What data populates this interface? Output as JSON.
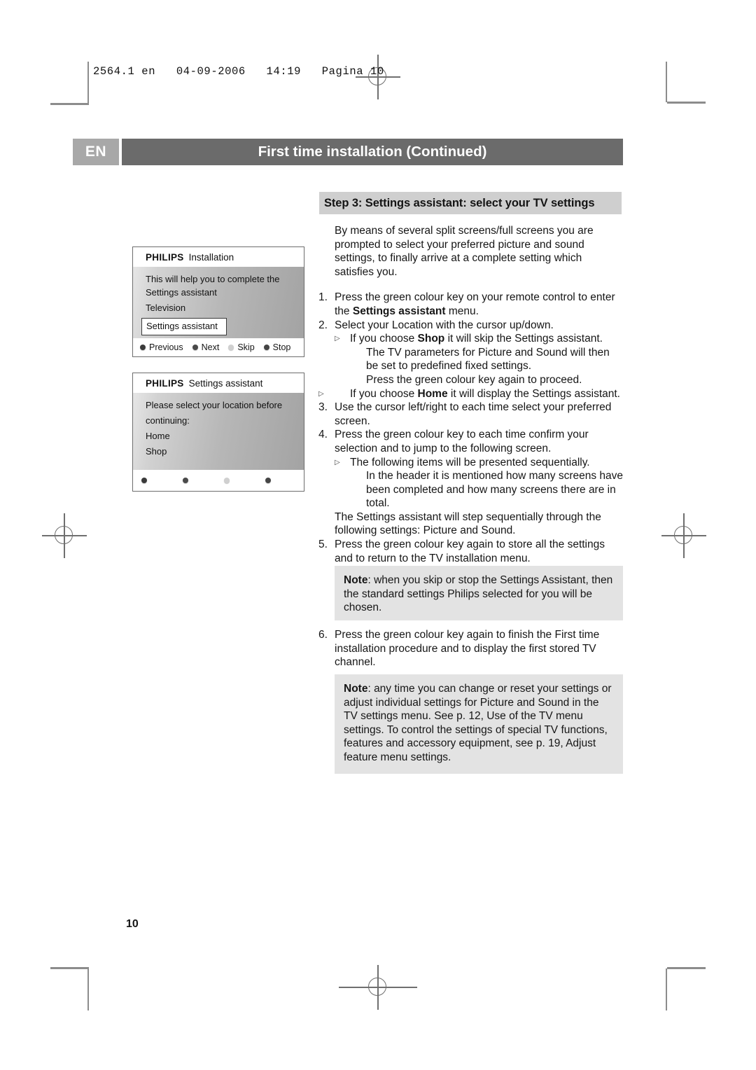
{
  "printer_slug": "2564.1 en   04-09-2006   14:19   Pagina 10",
  "header": {
    "language_code": "EN",
    "title": "First time installation  (Continued)"
  },
  "step_heading": "Step 3: Settings assistant: select your TV settings",
  "tv_screens": [
    {
      "brand": "PHILIPS",
      "title": "Installation",
      "lines": [
        "This will help you to complete the Settings assistant",
        "Television"
      ],
      "selected_item": "Settings assistant",
      "footer_buttons": [
        {
          "label": "Previous",
          "dot": "dark"
        },
        {
          "label": "Next",
          "dot": "mid"
        },
        {
          "label": "Skip",
          "dot": "light"
        },
        {
          "label": "Stop",
          "dot": "stop"
        }
      ]
    },
    {
      "brand": "PHILIPS",
      "title": "Settings assistant",
      "lines": [
        "Please select your location before",
        "continuing:",
        "Home",
        "Shop"
      ],
      "footer_buttons": [
        {
          "label": "",
          "dot": "dark"
        },
        {
          "label": "",
          "dot": "mid"
        },
        {
          "label": "",
          "dot": "light"
        },
        {
          "label": "",
          "dot": "stop"
        }
      ]
    }
  ],
  "body": {
    "intro": "By means of several split screens/full screens you are prompted to select your preferred picture and sound settings, to finally arrive at a complete setting which satisfies you.",
    "item1_num": "1.",
    "item1_a": "Press the green colour key on your remote control to enter the ",
    "item1_b": "Settings assistant",
    "item1_c": " menu.",
    "item2_num": "2.",
    "item2": "Select your Location with the cursor up/down.",
    "sub2a_a": "If you choose ",
    "sub2a_b": "Shop",
    "sub2a_c": " it will skip the Settings assistant.",
    "sub2a_line2": "The TV parameters for Picture and Sound will then be set to predefined fixed settings.",
    "sub2a_line3": "Press the green colour key again to proceed.",
    "sub2b_a": "If you choose ",
    "sub2b_b": "Home",
    "sub2b_c": " it will display the Settings assistant.",
    "item3_num": "3.",
    "item3": "Use the cursor left/right to each time select your preferred screen.",
    "item4_num": "4.",
    "item4": "Press the green colour key to each time confirm your selection and to jump to the following screen.",
    "sub4a": "The following items will be presented sequentially.",
    "sub4a_line2": "In the header it is mentioned how many screens have been completed and how many screens there are in total.",
    "trailing": "The Settings assistant will step sequentially through the following settings: Picture and Sound.",
    "item5_num": "5.",
    "item5": "Press the green colour key again to store all the settings and to return to the TV installation menu.",
    "item6_num": "6.",
    "item6": "Press the green colour key again to finish the First time installation procedure and to display the first stored TV channel."
  },
  "notes": [
    {
      "label": "Note",
      "text": ": when you skip or stop the Settings Assistant, then the standard settings Philips selected for you will be chosen."
    },
    {
      "label": "Note",
      "text": ": any time you can change or reset your settings or adjust individual settings for Picture and Sound in the TV settings menu. See p. 12, Use of the TV menu settings. To control the settings of special TV functions, features and accessory equipment, see p. 19, Adjust feature menu settings."
    }
  ],
  "page_number": "10"
}
